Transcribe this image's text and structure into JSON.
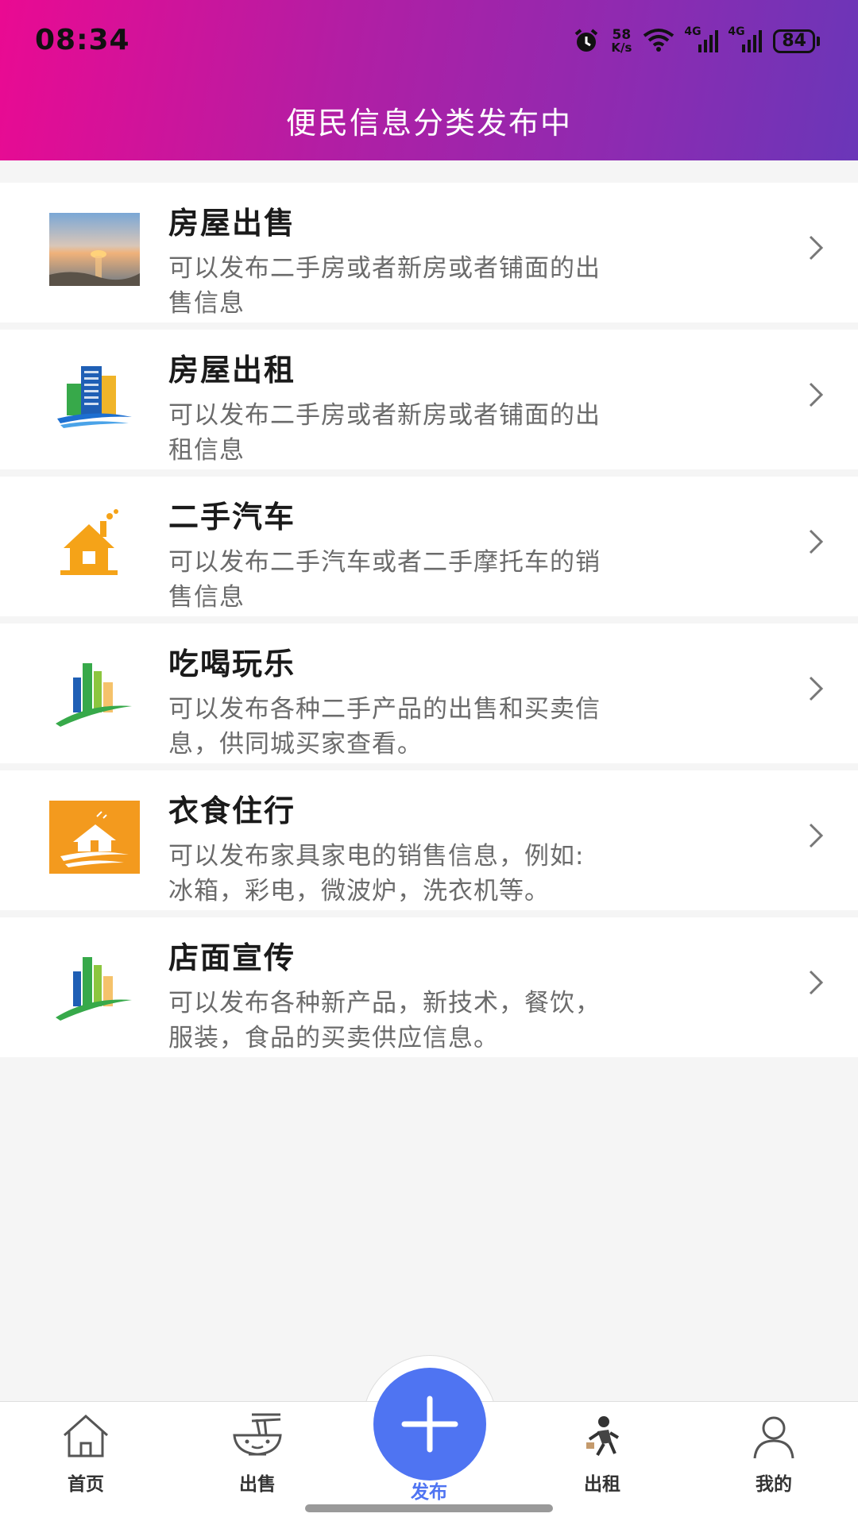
{
  "status_bar": {
    "time": "08:34",
    "net_speed_value": "58",
    "net_speed_unit": "K/s",
    "signal1_label": "4G",
    "signal2_label": "4G",
    "battery": "84"
  },
  "header": {
    "title": "便民信息分类发布中"
  },
  "categories": [
    {
      "name": "房屋出售",
      "line1": "可以发布二手房或者新房或者铺面的出",
      "line2": "售信息",
      "icon": "sunset-photo-icon"
    },
    {
      "name": "房屋出租",
      "line1": "可以发布二手房或者新房或者铺面的出",
      "line2": "租信息",
      "icon": "buildings-icon"
    },
    {
      "name": "二手汽车",
      "line1": "可以发布二手汽车或者二手摩托车的销",
      "line2": "售信息",
      "icon": "house-icon"
    },
    {
      "name": "吃喝玩乐",
      "line1": "可以发布各种二手产品的出售和买卖信",
      "line2": "息，供同城买家查看。",
      "icon": "bar-logo-icon"
    },
    {
      "name": "衣食住行",
      "line1": "可以发布家具家电的销售信息，例如:",
      "line2": "冰箱，彩电，微波炉，洗衣机等。",
      "icon": "orange-house-icon"
    },
    {
      "name": "店面宣传",
      "line1": "可以发布各种新产品，新技术，餐饮，",
      "line2": "服装，食品的买卖供应信息。",
      "icon": "bar-logo-icon"
    }
  ],
  "bottom_nav": {
    "home": "首页",
    "sell": "出售",
    "publish": "发布",
    "rent": "出租",
    "mine": "我的"
  },
  "colors": {
    "header_start": "#ea0a92",
    "header_end": "#6a36b8",
    "accent": "#4f74f2"
  }
}
